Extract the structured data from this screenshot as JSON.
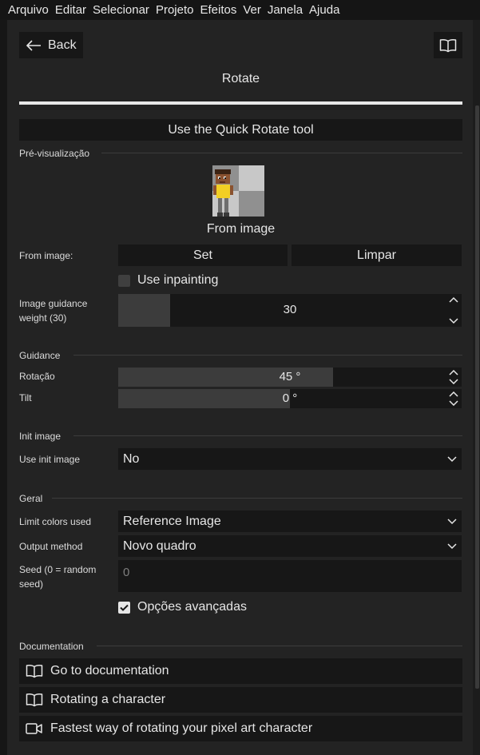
{
  "menu": [
    "Arquivo",
    "Editar",
    "Selecionar",
    "Projeto",
    "Efeitos",
    "Ver",
    "Janela",
    "Ajuda"
  ],
  "header": {
    "back_label": "Back",
    "title": "Rotate"
  },
  "quick_rotate_label": "Use the Quick Rotate tool",
  "preview": {
    "section_title": "Pré-visualização",
    "caption": "From image"
  },
  "from_image": {
    "label": "From image:",
    "set_label": "Set",
    "clear_label": "Limpar"
  },
  "use_inpainting": {
    "label": "Use inpainting",
    "checked": false
  },
  "image_guidance": {
    "label": "Image guidance weight (30)",
    "value": "30",
    "fraction": 0.15
  },
  "guidance": {
    "section_title": "Guidance",
    "rotation": {
      "label": "Rotação",
      "value": "45 °",
      "fraction": 0.625
    },
    "tilt": {
      "label": "Tilt",
      "value": "0 °",
      "fraction": 0.5
    }
  },
  "init_image": {
    "section_title": "Init image",
    "use_label": "Use init image",
    "use_value": "No"
  },
  "general": {
    "section_title": "Geral",
    "limit_colors_label": "Limit colors used",
    "limit_colors_value": "Reference Image",
    "output_method_label": "Output method",
    "output_method_value": "Novo quadro",
    "seed_label": "Seed (0 = random seed)",
    "seed_placeholder": "0",
    "advanced_label": "Opções avançadas",
    "advanced_checked": true
  },
  "documentation": {
    "section_title": "Documentation",
    "items": [
      {
        "label": "Go to documentation",
        "icon": "book-icon"
      },
      {
        "label": "Rotating a character",
        "icon": "book-icon"
      },
      {
        "label": "Fastest way of rotating your pixel art character",
        "icon": "video-icon"
      }
    ]
  },
  "colors": {
    "panel": "#232323",
    "control": "#171717",
    "fill": "#3c3c3c",
    "accent_bar": "#e8e8e8"
  }
}
